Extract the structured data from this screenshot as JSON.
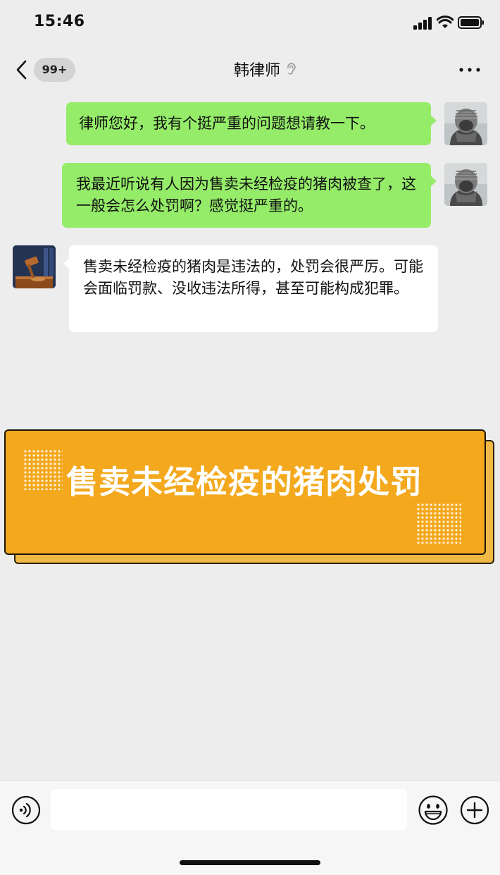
{
  "status": {
    "time": "15:46"
  },
  "nav": {
    "badge": "99+",
    "title": "韩律师"
  },
  "messages": [
    {
      "side": "out",
      "text": "律师您好，我有个挺严重的问题想请教一下。"
    },
    {
      "side": "out",
      "text": "我最近听说有人因为售卖未经检疫的猪肉被查了，这一般会怎么处罚啊？感觉挺严重的。"
    },
    {
      "side": "in",
      "text": "售卖未经检疫的猪肉是违法的，处罚会很严厉。可能会面临罚款、没收违法所得，甚至可能构成犯罪。"
    }
  ],
  "banner": {
    "title": "售卖未经检疫的猪肉处罚"
  },
  "input": {
    "value": "",
    "placeholder": ""
  },
  "icons": {
    "back": "chevron-left-icon",
    "ear": "ear-icon",
    "more": "more-icon",
    "voice": "voice-icon",
    "emoji": "emoji-icon",
    "plus": "plus-icon"
  },
  "colors": {
    "background": "#ededed",
    "bubble_out": "#95ec69",
    "bubble_in": "#ffffff",
    "banner": "#f3a81d"
  }
}
